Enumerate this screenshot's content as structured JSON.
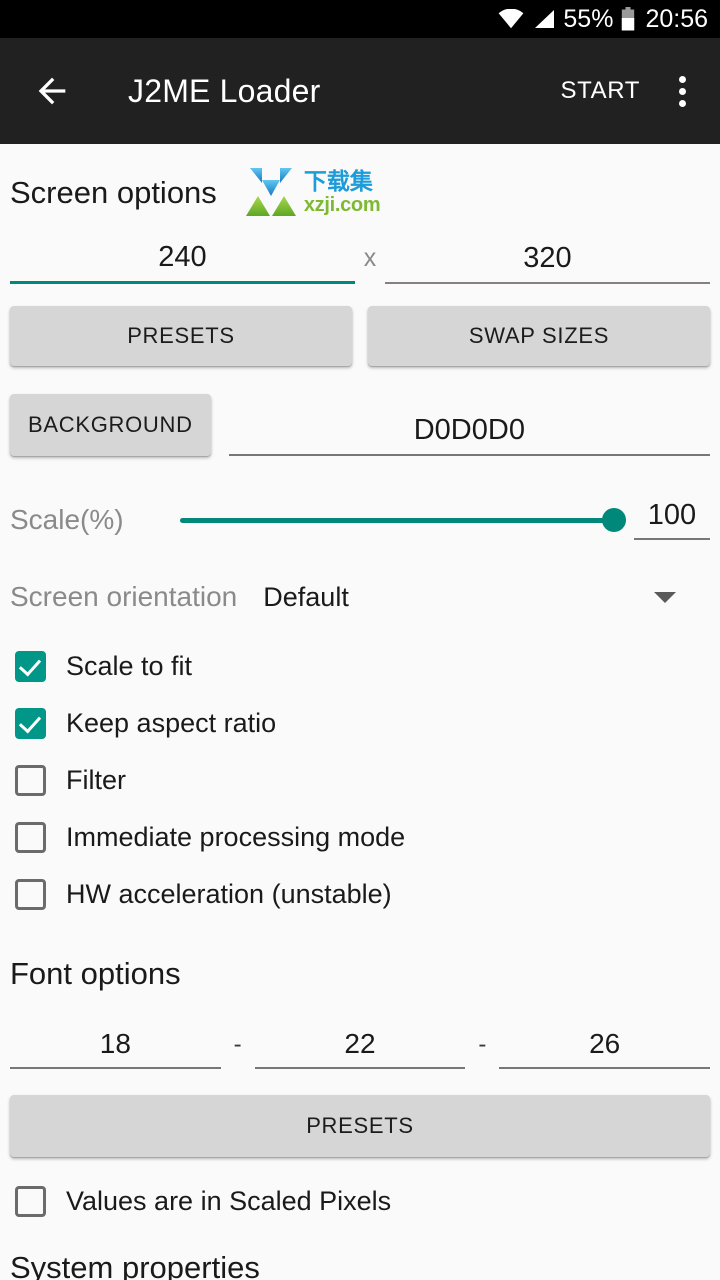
{
  "status_bar": {
    "battery_percent": "55%",
    "time": "20:56",
    "icons": [
      "wifi-icon",
      "signal-icon",
      "battery-icon"
    ]
  },
  "toolbar": {
    "back_icon": "back-arrow-icon",
    "title": "J2ME Loader",
    "start_label": "START",
    "overflow_icon": "overflow-menu-icon"
  },
  "watermark": {
    "cn_text": "下载集",
    "url_text": "xzji.com",
    "blue": "#1a9ad9",
    "green": "#7cb82f"
  },
  "screen_options": {
    "title": "Screen options",
    "width_value": "240",
    "separator": "x",
    "height_value": "320",
    "presets_label": "PRESETS",
    "swap_label": "SWAP SIZES",
    "background_label": "BACKGROUND",
    "background_value": "D0D0D0",
    "scale_label": "Scale(%)",
    "scale_value": "100",
    "scale_percent": 100,
    "orientation_label": "Screen orientation",
    "orientation_value": "Default",
    "checkboxes": [
      {
        "label": "Scale to fit",
        "checked": true
      },
      {
        "label": "Keep aspect ratio",
        "checked": true
      },
      {
        "label": "Filter",
        "checked": false
      },
      {
        "label": "Immediate processing mode",
        "checked": false
      },
      {
        "label": "HW acceleration (unstable)",
        "checked": false
      }
    ]
  },
  "font_options": {
    "title": "Font options",
    "small_value": "18",
    "dash1": "-",
    "medium_value": "22",
    "dash2": "-",
    "large_value": "26",
    "presets_label": "PRESETS",
    "scaled_pixels_label": "Values are in Scaled Pixels",
    "scaled_pixels_checked": false
  },
  "system_properties": {
    "title": "System properties"
  },
  "colors": {
    "accent": "#009688",
    "accent_dark": "#00897b",
    "toolbar_bg": "#212121",
    "status_bg": "#000000",
    "page_bg": "#fafafa",
    "button_bg": "#d6d6d6"
  }
}
